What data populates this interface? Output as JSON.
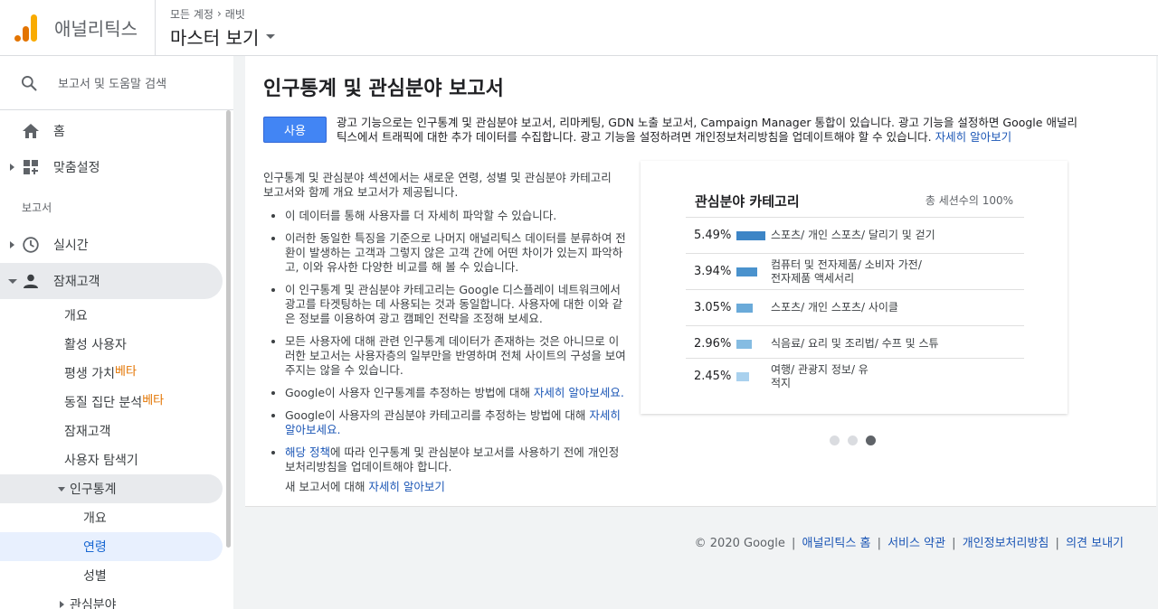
{
  "header": {
    "app_name": "애널리틱스",
    "breadcrumb": [
      "모든 계정",
      "래빗"
    ],
    "view_name": "마스터 보기"
  },
  "sidebar": {
    "search_placeholder": "보고서 및 도움말 검색",
    "home": "홈",
    "customization": "맞춤설정",
    "reports_section": "보고서",
    "realtime": "실시간",
    "audience": "잠재고객",
    "audience_items": [
      {
        "label": "개요"
      },
      {
        "label": "활성 사용자"
      },
      {
        "label": "평생 가치",
        "badge": "베타"
      },
      {
        "label": "동질 집단 분석",
        "badge": "베타"
      },
      {
        "label": "잠재고객"
      },
      {
        "label": "사용자 탐색기"
      }
    ],
    "demographics": "인구통계",
    "demographics_items": [
      "개요",
      "연령",
      "성별"
    ],
    "interests": "관심분야"
  },
  "main": {
    "title": "인구통계 및 관심분야 보고서",
    "enable_button": "사용",
    "notice_text": "광고 기능으로는 인구통계 및 관심분야 보고서, 리마케팅, GDN 노출 보고서, Campaign Manager 통합이 있습니다. 광고 기능을 설정하면 Google 애널리틱스에서 트래픽에 대한 추가 데이터를 수집합니다. 광고 기능을 설정하려면 개인정보처리방침을 업데이트해야 할 수 있습니다.",
    "notice_link": "자세히 알아보기",
    "intro": "인구통계 및 관심분야 섹션에서는 새로운 연령, 성별 및 관심분야 카테고리 보고서와 함께 개요 보고서가 제공됩니다.",
    "bullets": [
      {
        "text": "이 데이터를 통해 사용자를 더 자세히 파악할 수 있습니다."
      },
      {
        "text": "이러한 동일한 특징을 기준으로 나머지 애널리틱스 데이터를 분류하여 전환이 발생하는 고객과 그렇지 않은 고객 간에 어떤 차이가 있는지 파악하고, 이와 유사한 다양한 비교를 해 볼 수 있습니다."
      },
      {
        "text": "이 인구통계 및 관심분야 카테고리는 Google 디스플레이 네트워크에서 광고를 타겟팅하는 데 사용되는 것과 동일합니다. 사용자에 대한 이와 같은 정보를 이용하여 광고 캠페인 전략을 조정해 보세요."
      },
      {
        "text": "모든 사용자에 대해 관련 인구통계 데이터가 존재하는 것은 아니므로 이러한 보고서는 사용자층의 일부만을 반영하며 전체 사이트의 구성을 보여 주지는 않을 수 있습니다."
      },
      {
        "text": "Google이 사용자 인구통계를 추정하는 방법에 대해 ",
        "link": "자세히 알아보세요."
      },
      {
        "text": "Google이 사용자의 관심분야 카테고리를 추정하는 방법에 대해 ",
        "link": "자세히 알아보세요."
      },
      {
        "link_first": "해당 정책",
        "text": "에 따라 인구통계 및 관심분야 보고서를 사용하기 전에 개인정보처리방침을 업데이트해야 합니다."
      }
    ],
    "final_text": "새 보고서에 대해 ",
    "final_link": "자세히 알아보기"
  },
  "panel": {
    "title": "관심분야 카테고리",
    "subtitle": "총 세션수의 100%",
    "rows": [
      {
        "pct": "5.49%",
        "value": 5.49,
        "name": "스포츠/ 개인 스포츠/ 달리기 및 걷기",
        "color": "#3d85c6"
      },
      {
        "pct": "3.94%",
        "value": 3.94,
        "name": "컴퓨터 및 전자제품/ 소비자 가전/ 전자제품 액세서리",
        "color": "#4a92cd"
      },
      {
        "pct": "3.05%",
        "value": 3.05,
        "name": "스포츠/ 개인 스포츠/ 사이클",
        "color": "#6aaad9"
      },
      {
        "pct": "2.96%",
        "value": 2.96,
        "name": "식음료/ 요리 및 조리법/ 수프 및 스튜",
        "color": "#85bce2"
      },
      {
        "pct": "2.45%",
        "value": 2.45,
        "name": "여행/ 관광지 정보/ 유적지",
        "color": "#a9d1ee"
      }
    ],
    "carousel_active_index": 2
  },
  "footer": {
    "copyright": "© 2020 Google",
    "links": [
      "애널리틱스 홈",
      "서비스 약관",
      "개인정보처리방침",
      "의견 보내기"
    ]
  }
}
